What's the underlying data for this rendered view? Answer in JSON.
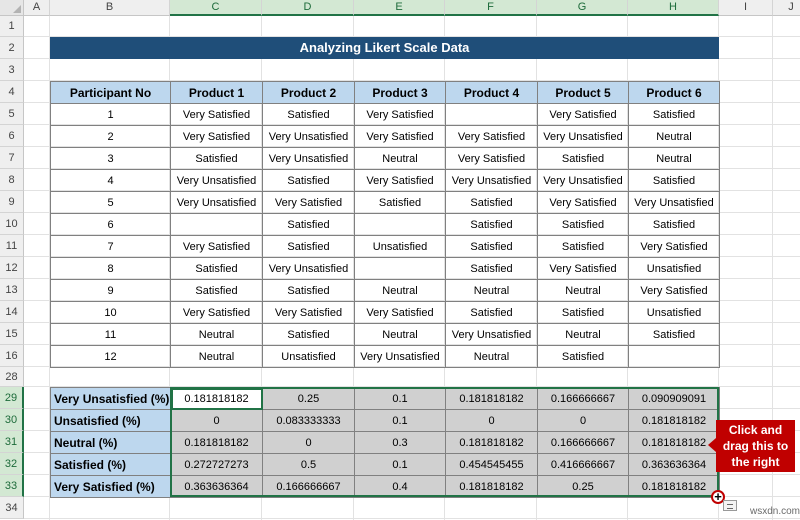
{
  "columns": [
    "A",
    "B",
    "C",
    "D",
    "E",
    "F",
    "G",
    "H",
    "I",
    "J"
  ],
  "rows": [
    "1",
    "2",
    "3",
    "4",
    "5",
    "6",
    "7",
    "8",
    "9",
    "10",
    "11",
    "12",
    "13",
    "14",
    "15",
    "16",
    "28",
    "29",
    "30",
    "31",
    "32",
    "33",
    "34"
  ],
  "title": "Analyzing Likert Scale Data",
  "table1": {
    "headers": [
      "Participant No",
      "Product 1",
      "Product 2",
      "Product 3",
      "Product 4",
      "Product 5",
      "Product 6"
    ],
    "rows": [
      [
        "1",
        "Very Satisfied",
        "Satisfied",
        "Very Satisfied",
        "",
        "Very Satisfied",
        "Satisfied"
      ],
      [
        "2",
        "Very Satisfied",
        "Very Unsatisfied",
        "Very Satisfied",
        "Very Satisfied",
        "Very Unsatisfied",
        "Neutral"
      ],
      [
        "3",
        "Satisfied",
        "Very Unsatisfied",
        "Neutral",
        "Very Satisfied",
        "Satisfied",
        "Neutral"
      ],
      [
        "4",
        "Very Unsatisfied",
        "Satisfied",
        "Very Satisfied",
        "Very Unsatisfied",
        "Very Unsatisfied",
        "Satisfied"
      ],
      [
        "5",
        "Very Unsatisfied",
        "Very Satisfied",
        "Satisfied",
        "Satisfied",
        "Very Satisfied",
        "Very Unsatisfied"
      ],
      [
        "6",
        "",
        "Satisfied",
        "",
        "Satisfied",
        "Satisfied",
        "Satisfied"
      ],
      [
        "7",
        "Very Satisfied",
        "Satisfied",
        "Unsatisfied",
        "Satisfied",
        "Satisfied",
        "Very Satisfied"
      ],
      [
        "8",
        "Satisfied",
        "Very Unsatisfied",
        "",
        "Satisfied",
        "Very Satisfied",
        "Unsatisfied"
      ],
      [
        "9",
        "Satisfied",
        "Satisfied",
        "Neutral",
        "Neutral",
        "Neutral",
        "Very Satisfied"
      ],
      [
        "10",
        "Very Satisfied",
        "Very Satisfied",
        "Very Satisfied",
        "Satisfied",
        "Satisfied",
        "Unsatisfied"
      ],
      [
        "11",
        "Neutral",
        "Satisfied",
        "Neutral",
        "Very Unsatisfied",
        "Neutral",
        "Satisfied"
      ],
      [
        "12",
        "Neutral",
        "Unsatisfied",
        "Very Unsatisfied",
        "Neutral",
        "Satisfied",
        ""
      ]
    ]
  },
  "table2": {
    "rows": [
      [
        "Very Unsatisfied (%)",
        "0.181818182",
        "0.25",
        "0.1",
        "0.181818182",
        "0.166666667",
        "0.090909091"
      ],
      [
        "Unsatisfied (%)",
        "0",
        "0.083333333",
        "0.1",
        "0",
        "0",
        "0.181818182"
      ],
      [
        "Neutral (%)",
        "0.181818182",
        "0",
        "0.3",
        "0.181818182",
        "0.166666667",
        "0.181818182"
      ],
      [
        "Satisfied (%)",
        "0.272727273",
        "0.5",
        "0.1",
        "0.454545455",
        "0.416666667",
        "0.363636364"
      ],
      [
        "Very Satisfied (%)",
        "0.363636364",
        "0.166666667",
        "0.4",
        "0.181818182",
        "0.25",
        "0.181818182"
      ]
    ]
  },
  "callout": "Click and drag this to the right",
  "watermark": "wsxdn.com",
  "colors": {
    "title_bg": "#1f4e79",
    "header_bg": "#bdd7ee",
    "result_bg": "#d0d0d0",
    "callout_bg": "#c00000",
    "selection": "#217346"
  }
}
